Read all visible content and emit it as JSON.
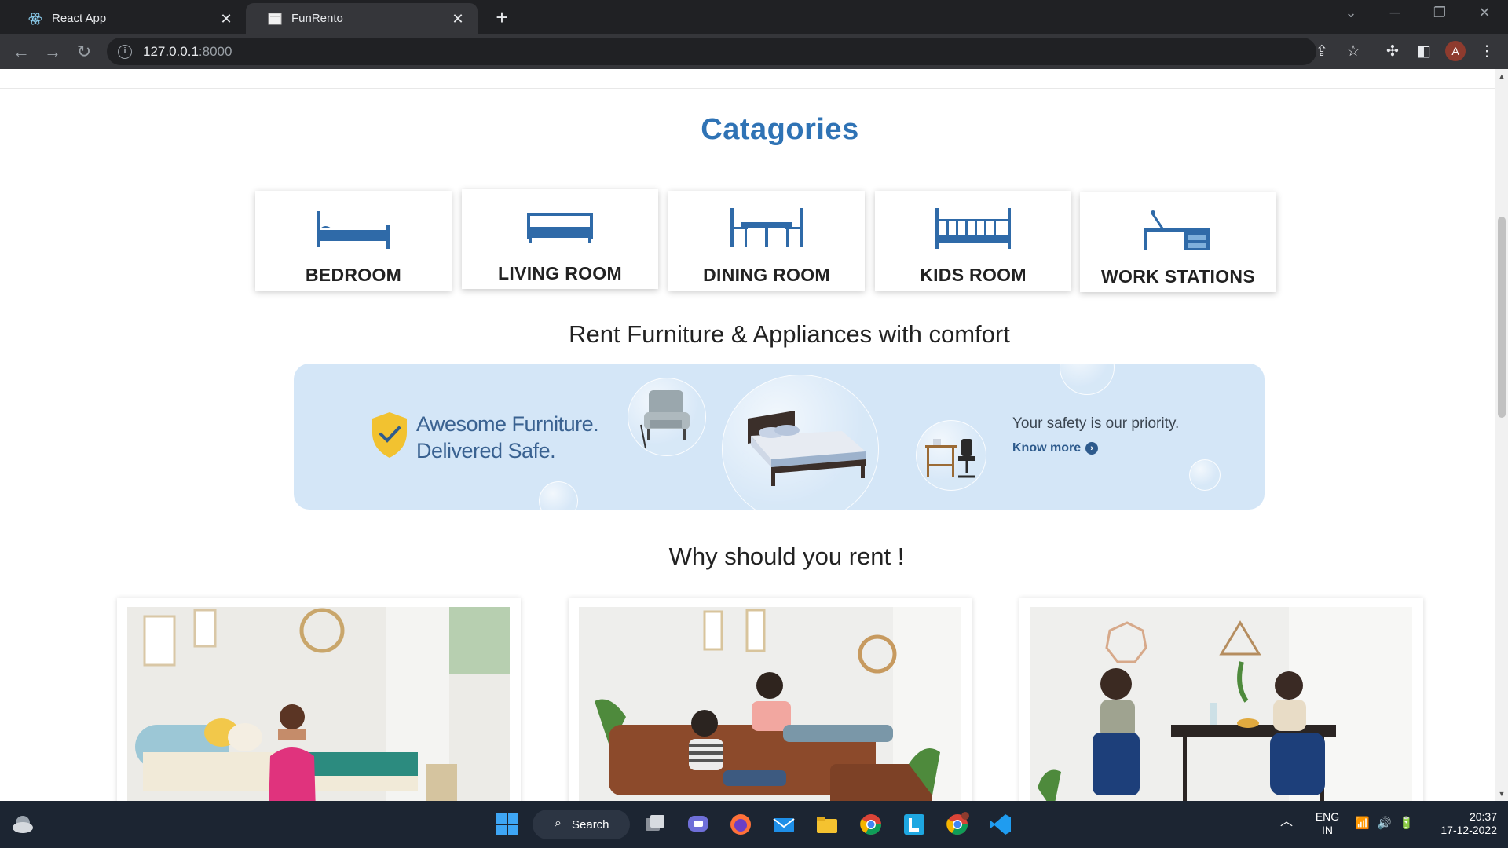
{
  "browser": {
    "tabs": [
      {
        "label": "React App",
        "active": false
      },
      {
        "label": "FunRento",
        "active": true
      }
    ],
    "url_host": "127.0.0.1",
    "url_port": ":8000",
    "profile_initial": "A"
  },
  "page": {
    "categories_title": "Catagories",
    "categories": [
      {
        "label": "BEDROOM",
        "icon": "bed-icon"
      },
      {
        "label": "LIVING ROOM",
        "icon": "sofa-icon"
      },
      {
        "label": "DINING ROOM",
        "icon": "dining-table-icon"
      },
      {
        "label": "KIDS ROOM",
        "icon": "crib-icon"
      },
      {
        "label": "WORK STATIONS",
        "icon": "desk-lamp-icon"
      }
    ],
    "tagline": "Rent Furniture & Appliances with comfort",
    "banner": {
      "headline_line1": "Awesome Furniture.",
      "headline_line2": "Delivered Safe.",
      "safety_text": "Your safety is our priority.",
      "know_more": "Know more"
    },
    "why_title": "Why should you rent !",
    "why_cards": [
      {
        "image": "woman-meditating-bedroom"
      },
      {
        "image": "men-gaming-on-sofa"
      },
      {
        "image": "women-at-dining-table"
      }
    ]
  },
  "taskbar": {
    "search_label": "Search",
    "language_line1": "ENG",
    "language_line2": "IN",
    "time": "20:37",
    "date": "17-12-2022"
  },
  "colors": {
    "accent": "#2f73b5",
    "banner_bg": "#d4e6f7",
    "chrome_dark": "#202124",
    "taskbar": "#1c2532"
  }
}
